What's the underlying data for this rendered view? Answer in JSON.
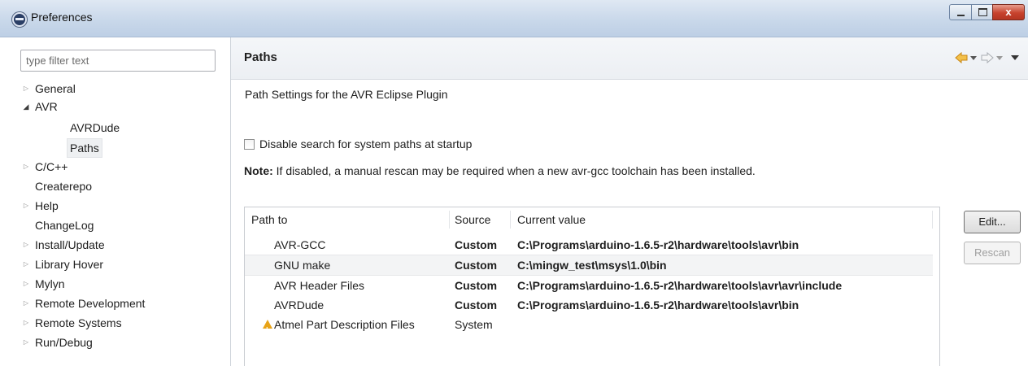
{
  "window": {
    "title": "Preferences",
    "close_glyph": "x"
  },
  "filter": {
    "placeholder": "type filter text"
  },
  "tree": {
    "items": [
      {
        "label": "General",
        "twisty": "collapsed"
      },
      {
        "label": "AVR",
        "twisty": "expanded"
      },
      {
        "label": "AVRDude",
        "twisty": "none"
      },
      {
        "label": "Paths",
        "twisty": "none",
        "selected": true
      },
      {
        "label": "C/C++",
        "twisty": "collapsed"
      },
      {
        "label": "Createrepo",
        "twisty": "none"
      },
      {
        "label": "Help",
        "twisty": "collapsed"
      },
      {
        "label": "ChangeLog",
        "twisty": "none"
      },
      {
        "label": "Install/Update",
        "twisty": "collapsed"
      },
      {
        "label": "Library Hover",
        "twisty": "collapsed"
      },
      {
        "label": "Mylyn",
        "twisty": "collapsed"
      },
      {
        "label": "Remote Development",
        "twisty": "collapsed"
      },
      {
        "label": "Remote Systems",
        "twisty": "collapsed"
      },
      {
        "label": "Run/Debug",
        "twisty": "collapsed"
      }
    ]
  },
  "page": {
    "title": "Paths",
    "description": "Path Settings for the AVR Eclipse Plugin",
    "checkbox_label": "Disable search for system paths at startup",
    "checkbox_checked": false,
    "note_label": "Note:",
    "note_text": " If disabled, a manual rescan may be required when a new avr-gcc toolchain has been installed."
  },
  "table": {
    "headers": {
      "path": "Path to",
      "source": "Source",
      "value": "Current value"
    },
    "rows": [
      {
        "path": "AVR-GCC",
        "source": "Custom",
        "value": "C:\\Programs\\arduino-1.6.5-r2\\hardware\\tools\\avr\\bin"
      },
      {
        "path": "GNU make",
        "source": "Custom",
        "value": "C:\\mingw_test\\msys\\1.0\\bin"
      },
      {
        "path": "AVR Header Files",
        "source": "Custom",
        "value": "C:\\Programs\\arduino-1.6.5-r2\\hardware\\tools\\avr\\avr\\include"
      },
      {
        "path": "AVRDude",
        "source": "Custom",
        "value": "C:\\Programs\\arduino-1.6.5-r2\\hardware\\tools\\avr\\bin"
      },
      {
        "path": "Atmel Part Description Files",
        "source": "System",
        "value": "",
        "icon": "warning-icon"
      }
    ]
  },
  "buttons": {
    "edit": "Edit...",
    "rescan": "Rescan"
  },
  "colors": {
    "nav_arrow": "#e8a11a",
    "warning": "#e8a317"
  }
}
